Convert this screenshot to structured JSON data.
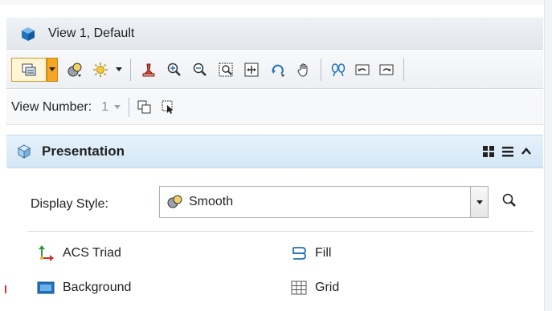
{
  "window": {
    "title": "View 1, Default"
  },
  "toolbar": {
    "icons": [
      "view-attributes-icon",
      "display-style-icon",
      "lighting-icon",
      "update-view-icon",
      "zoom-in-icon",
      "zoom-out-icon",
      "window-area-icon",
      "fit-view-icon",
      "rotate-view-icon",
      "pan-view-icon",
      "camera-icon",
      "previous-view-icon",
      "next-view-icon"
    ]
  },
  "view_number": {
    "label": "View Number:",
    "value": "1"
  },
  "presentation": {
    "title": "Presentation",
    "display_style": {
      "label": "Display Style:",
      "value": "Smooth"
    },
    "items": [
      {
        "label": "ACS Triad",
        "icon": "acs-triad-icon"
      },
      {
        "label": "Fill",
        "icon": "fill-icon"
      },
      {
        "label": "Background",
        "icon": "background-icon"
      },
      {
        "label": "Grid",
        "icon": "grid-icon"
      }
    ]
  },
  "colors": {
    "accent": "#f5a623",
    "panel_header": "#d9eaf7",
    "brand_blue": "#1e73be"
  }
}
